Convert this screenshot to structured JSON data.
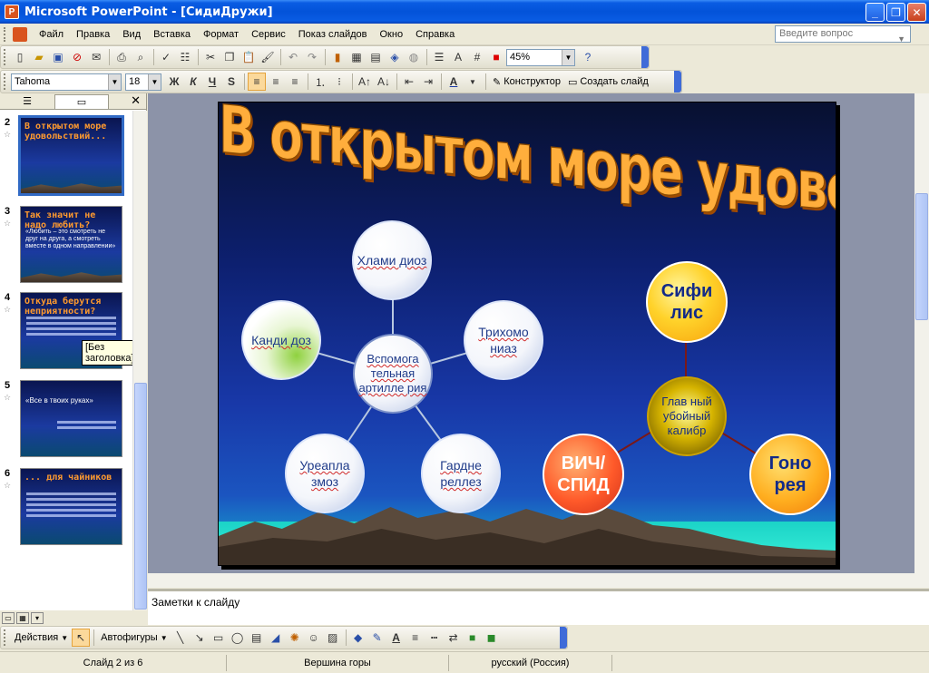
{
  "window": {
    "title": "Microsoft PowerPoint - [СидиДружи]",
    "minimize": "_",
    "maximize": "❐",
    "close": "✕"
  },
  "menu": {
    "items": [
      "Файл",
      "Правка",
      "Вид",
      "Вставка",
      "Формат",
      "Сервис",
      "Показ слайдов",
      "Окно",
      "Справка"
    ],
    "help_placeholder": "Введите вопрос"
  },
  "toolbar_standard": {
    "zoom": "45%"
  },
  "toolbar_format": {
    "font": "Tahoma",
    "size": "18",
    "bold": "Ж",
    "italic": "К",
    "underline": "Ч",
    "shadow": "S",
    "design_label": "Конструктор",
    "new_slide_label": "Создать слайд"
  },
  "left_pane": {
    "tooltip": "[Без заголовка]",
    "thumbs": [
      {
        "num": "2",
        "title": "В открытом море удовольствий...",
        "selected": true
      },
      {
        "num": "3",
        "title": "Так значит не надо любить?",
        "body": "«Любить – это смотреть не друг на друга, а смотреть вместе в одном направлении»"
      },
      {
        "num": "4",
        "title": "Откуда берутся неприятности?"
      },
      {
        "num": "5",
        "title": "",
        "body": "«Все в твоих руках»"
      },
      {
        "num": "6",
        "title": "... для чайников"
      }
    ]
  },
  "slide": {
    "title": "В открытом море  удовольствий...",
    "hub": "Вспомога тельная артилле рия",
    "nodes": {
      "top": "Хлами диоз",
      "left": "Канди доз",
      "right": "Трихомо ниаз",
      "bottom_left": "Уреапла змоз",
      "bottom_right": "Гардне реллез"
    },
    "main_caliber": "Глав ный убойный калибр",
    "balls": {
      "top": "Сифи лис",
      "left": "ВИЧ/ СПИД",
      "right": "Гоно рея"
    }
  },
  "notes": {
    "text": "Заметки к слайду"
  },
  "drawing_toolbar": {
    "actions_label": "Действия",
    "autoshapes_label": "Автофигуры"
  },
  "status": {
    "slide": "Слайд 2 из 6",
    "design": "Вершина горы",
    "language": "русский (Россия)"
  }
}
